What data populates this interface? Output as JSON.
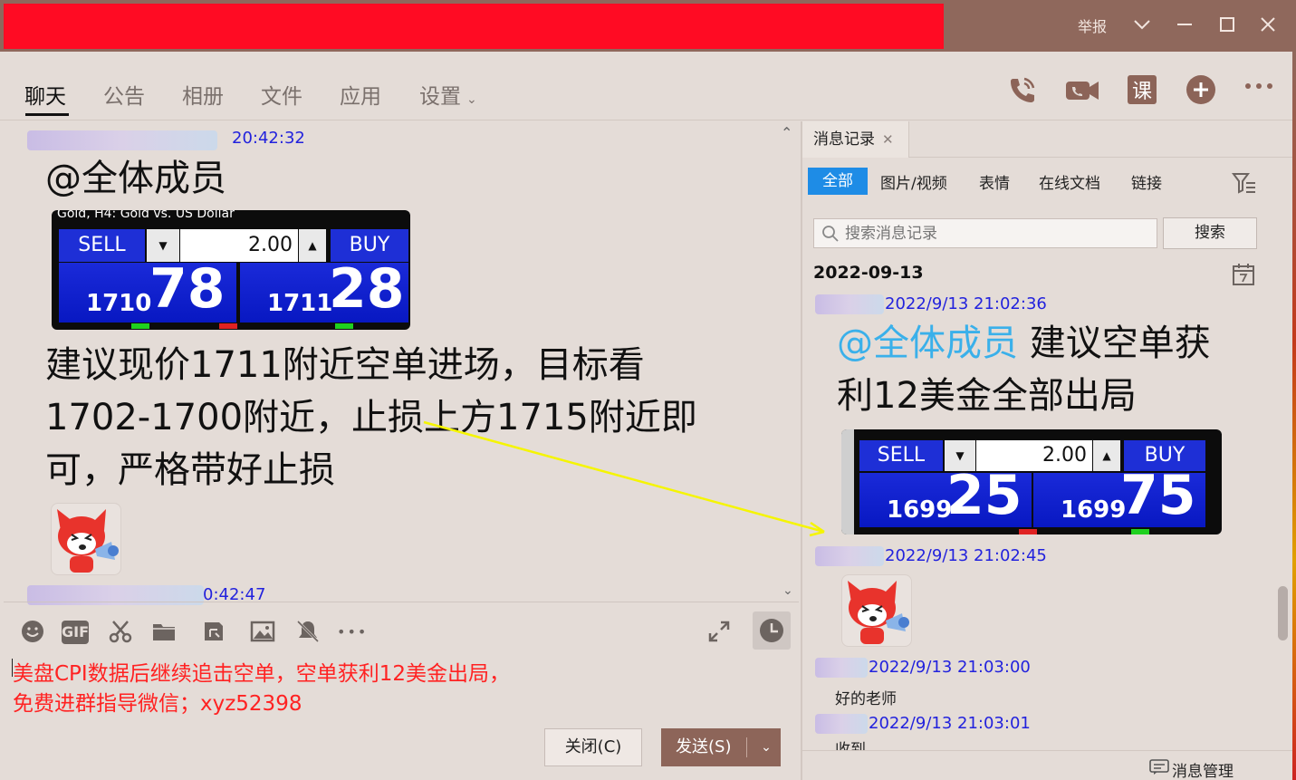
{
  "window": {
    "report_label": "举报",
    "minimize_icon": "minimize-icon",
    "maximize_icon": "maximize-icon",
    "close_icon": "close-icon"
  },
  "nav": {
    "tabs": [
      {
        "label": "聊天",
        "active": true
      },
      {
        "label": "公告"
      },
      {
        "label": "相册"
      },
      {
        "label": "文件"
      },
      {
        "label": "应用"
      },
      {
        "label": "设置"
      }
    ],
    "icons": [
      "phone-icon",
      "video-call-icon",
      "lesson-icon",
      "add-app-icon",
      "more-icon"
    ],
    "lesson_glyph": "课"
  },
  "chat": {
    "messages": [
      {
        "time": "20:42:32",
        "mention": "@全体成员",
        "widget": {
          "header": "Gold, H4:  Gold vs. US Dollar",
          "sell": "SELL",
          "buy": "BUY",
          "lot": "2.00",
          "bid_small": "1710",
          "bid_large": "78",
          "ask_small": "1711",
          "ask_large": "28"
        },
        "text": [
          "建议现价1711附近空单进场，目标看",
          "1702-1700附近，止损上方1715附近即",
          "可，严格带好止损"
        ]
      },
      {
        "time": "0:42:47"
      }
    ]
  },
  "toolbar": {
    "icons": [
      "emoji-icon",
      "gif-icon",
      "screenshot-icon",
      "folder-icon",
      "file-transfer-icon",
      "image-icon",
      "mute-icon",
      "more-tools-icon"
    ],
    "gif_label": "GIF",
    "more_label": "•••"
  },
  "compose": {
    "lines": [
      "美盘CPI数据后继续追击空单，空单获利12美金出局，",
      "免费进群指导微信；xyz52398"
    ]
  },
  "buttons": {
    "close": "关闭(C)",
    "send": "发送(S)"
  },
  "history": {
    "tab_label": "消息记录",
    "filters": [
      "全部",
      "图片/视频",
      "表情",
      "在线文档",
      "链接"
    ],
    "search_placeholder": "搜索消息记录",
    "search_button": "搜索",
    "date": "2022-09-13",
    "entries": [
      {
        "time": "2022/9/13 21:02:36",
        "mention": "@全体成员",
        "text_1": " 建议空单获",
        "text_2": "利12美金全部出局"
      },
      {
        "time": "2022/9/13 21:02:45"
      },
      {
        "time": "2022/9/13 21:03:00",
        "text": "好的老师"
      },
      {
        "time": "2022/9/13 21:03:01",
        "text": "收到"
      }
    ],
    "widget": {
      "sell": "SELL",
      "buy": "BUY",
      "lot": "2.00",
      "bid_small": "1699",
      "bid_large": "25",
      "ask_small": "1699",
      "ask_large": "75"
    },
    "manage_label": "消息管理"
  },
  "colors": {
    "titlebar_red": "#ff0b23",
    "titlebar_brown": "#8f685c",
    "accent_blue": "#1e8ce6",
    "send_button": "#8d6559",
    "compose_text": "#ff2222",
    "timestamp": "#2222dd",
    "mention": "#3ab0ea"
  }
}
